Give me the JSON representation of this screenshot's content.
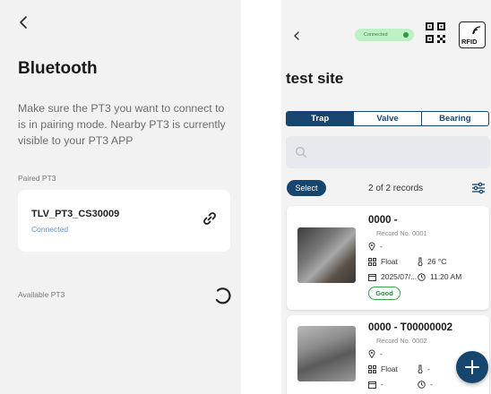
{
  "bluetooth_screen": {
    "title": "Bluetooth",
    "description": "Make sure the PT3 you want to connect to is in pairing mode. Nearby PT3 is currently visible to your PT3 APP",
    "paired_label": "Paired PT3",
    "paired_device": {
      "name": "TLV_PT3_CS30009",
      "status": "Connected"
    },
    "available_label": "Available PT3"
  },
  "site_screen": {
    "connection_badge": "Connected",
    "rfid_label": "RFID",
    "title": "test site",
    "tabs": [
      {
        "label": "Trap",
        "active": true
      },
      {
        "label": "Valve",
        "active": false
      },
      {
        "label": "Bearing",
        "active": false
      }
    ],
    "search": {
      "placeholder": ""
    },
    "select_label": "Select",
    "records_count": "2 of 2 records",
    "records": [
      {
        "title": "0000 -",
        "record_no": "Record No. 0001",
        "location": "-",
        "type": "Float",
        "temperature": "26 °C",
        "date": "2025/07/...",
        "time": "11:20 AM",
        "status": "Good"
      },
      {
        "title": "0000 - T00000002",
        "record_no": "Record No. 0002",
        "location": "-",
        "type": "Float",
        "temperature": "-",
        "date": "-",
        "time": "-"
      }
    ]
  },
  "colors": {
    "primary": "#16466e",
    "good": "#3aa34b",
    "link": "#5a97c6"
  }
}
